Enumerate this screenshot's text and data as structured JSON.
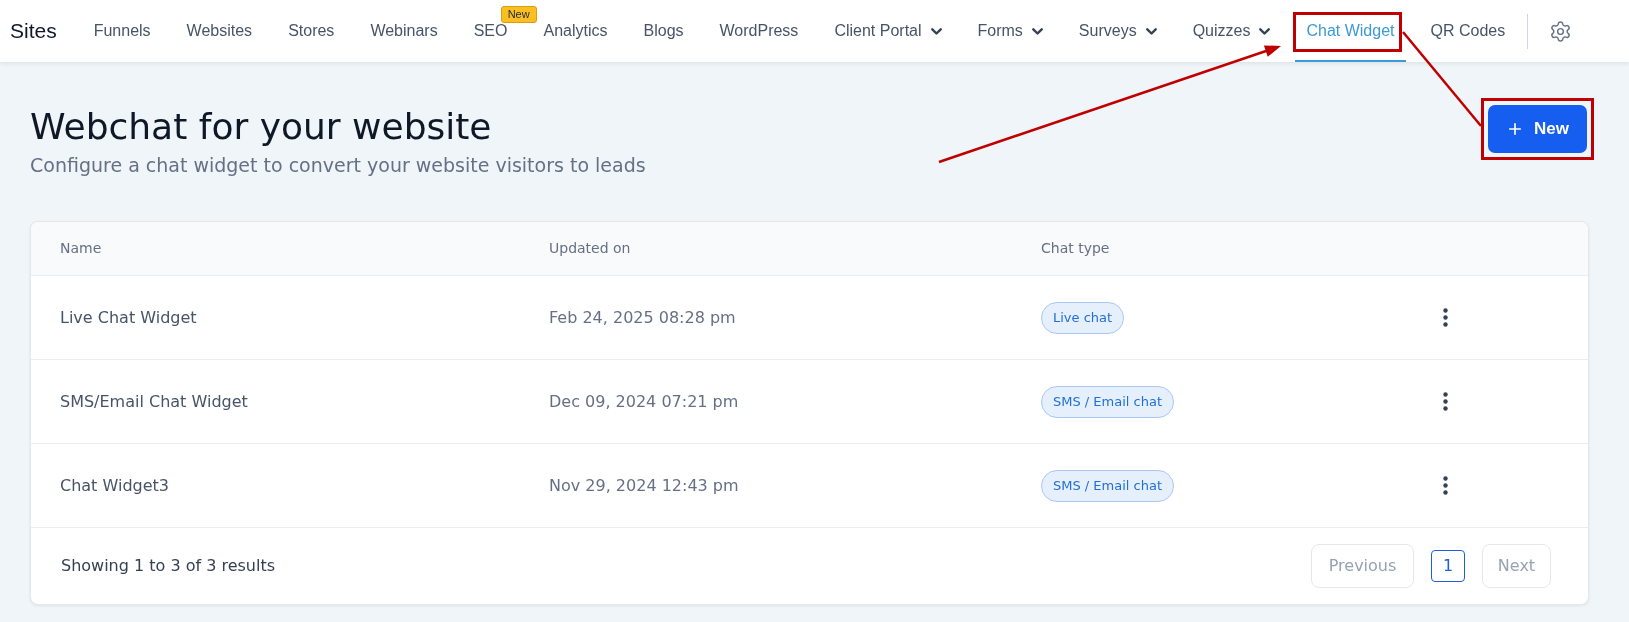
{
  "nav": {
    "brand": "Sites",
    "items": [
      {
        "label": "Funnels",
        "selected": false,
        "dropdown": false,
        "highlighted": false
      },
      {
        "label": "Websites",
        "selected": false,
        "dropdown": false,
        "highlighted": false
      },
      {
        "label": "Stores",
        "selected": false,
        "dropdown": false,
        "highlighted": false
      },
      {
        "label": "Webinars",
        "selected": false,
        "dropdown": false,
        "highlighted": false
      },
      {
        "label": "SEO",
        "selected": false,
        "dropdown": false,
        "highlighted": false,
        "badge": "New"
      },
      {
        "label": "Analytics",
        "selected": false,
        "dropdown": false,
        "highlighted": false
      },
      {
        "label": "Blogs",
        "selected": false,
        "dropdown": false,
        "highlighted": false
      },
      {
        "label": "WordPress",
        "selected": false,
        "dropdown": false,
        "highlighted": false
      },
      {
        "label": "Client Portal",
        "selected": false,
        "dropdown": true,
        "highlighted": false
      },
      {
        "label": "Forms",
        "selected": false,
        "dropdown": true,
        "highlighted": false
      },
      {
        "label": "Surveys",
        "selected": false,
        "dropdown": true,
        "highlighted": false
      },
      {
        "label": "Quizzes",
        "selected": false,
        "dropdown": true,
        "highlighted": false
      },
      {
        "label": "Chat Widget",
        "selected": true,
        "dropdown": false,
        "highlighted": true
      },
      {
        "label": "QR Codes",
        "selected": false,
        "dropdown": false,
        "highlighted": false
      }
    ]
  },
  "header": {
    "title": "Webchat for your website",
    "subtitle": "Configure a chat widget to convert your website visitors to leads",
    "new_button": {
      "label": "New",
      "highlighted": true
    }
  },
  "table": {
    "columns": [
      "Name",
      "Updated on",
      "Chat type"
    ],
    "rows": [
      {
        "name": "Live Chat Widget",
        "updated_on": "Feb 24, 2025 08:28 pm",
        "chat_type": "Live chat"
      },
      {
        "name": "SMS/Email Chat Widget",
        "updated_on": "Dec 09, 2024 07:21 pm",
        "chat_type": "SMS / Email chat"
      },
      {
        "name": "Chat Widget3",
        "updated_on": "Nov 29, 2024 12:43 pm",
        "chat_type": "SMS / Email chat"
      }
    ],
    "footer": {
      "summary": "Showing 1 to 3 of 3 results",
      "previous": {
        "label": "Previous",
        "disabled": true
      },
      "pages": [
        {
          "label": "1",
          "selected": true
        }
      ],
      "next": {
        "label": "Next",
        "disabled": true
      }
    }
  }
}
